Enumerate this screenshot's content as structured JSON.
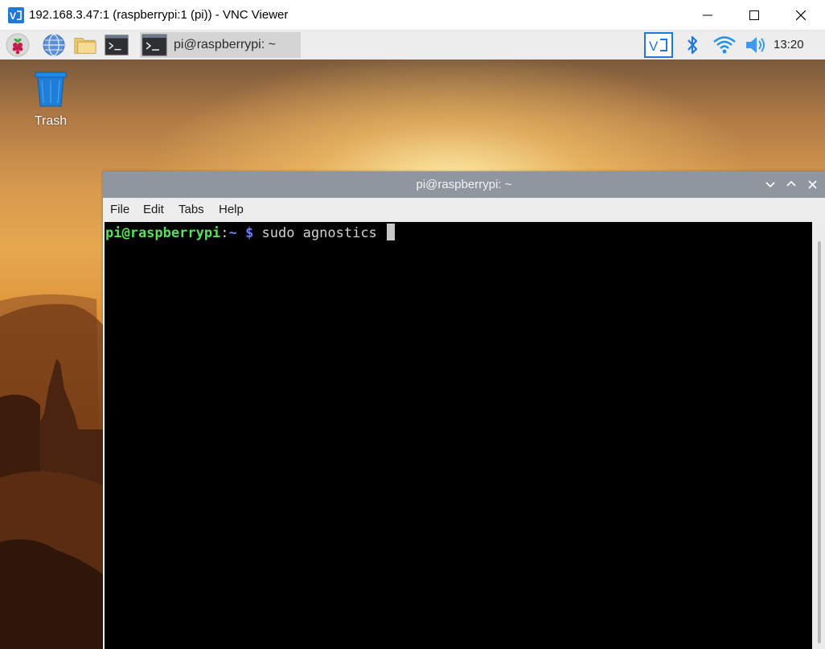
{
  "vnc_window": {
    "title": "192.168.3.47:1 (raspberrypi:1 (pi)) - VNC Viewer",
    "controls": {
      "minimize": "minimize-icon",
      "maximize": "maximize-icon",
      "close": "close-icon"
    }
  },
  "taskbar": {
    "launchers": [
      "raspberry-menu-icon",
      "web-browser-icon",
      "file-manager-icon",
      "terminal-icon"
    ],
    "task_button": {
      "label": "pi@raspberrypi: ~",
      "icon": "terminal-icon"
    },
    "tray": [
      "vnc-server-icon",
      "bluetooth-icon",
      "wifi-icon",
      "volume-icon"
    ],
    "clock": "13:20"
  },
  "desktop": {
    "icons": [
      {
        "label": "Trash",
        "icon": "trash-icon"
      }
    ]
  },
  "terminal": {
    "title": "pi@raspberrypi: ~",
    "menu": [
      "File",
      "Edit",
      "Tabs",
      "Help"
    ],
    "prompt_user": "pi@raspberrypi",
    "prompt_sep": ":",
    "prompt_path": "~ $",
    "command": " sudo agnostics "
  },
  "colors": {
    "vnc_accent": "#1f7ad6",
    "prompt_user": "#58e05a",
    "prompt_path": "#6d7cf7",
    "terminal_title_bg": "#8f96a0"
  }
}
